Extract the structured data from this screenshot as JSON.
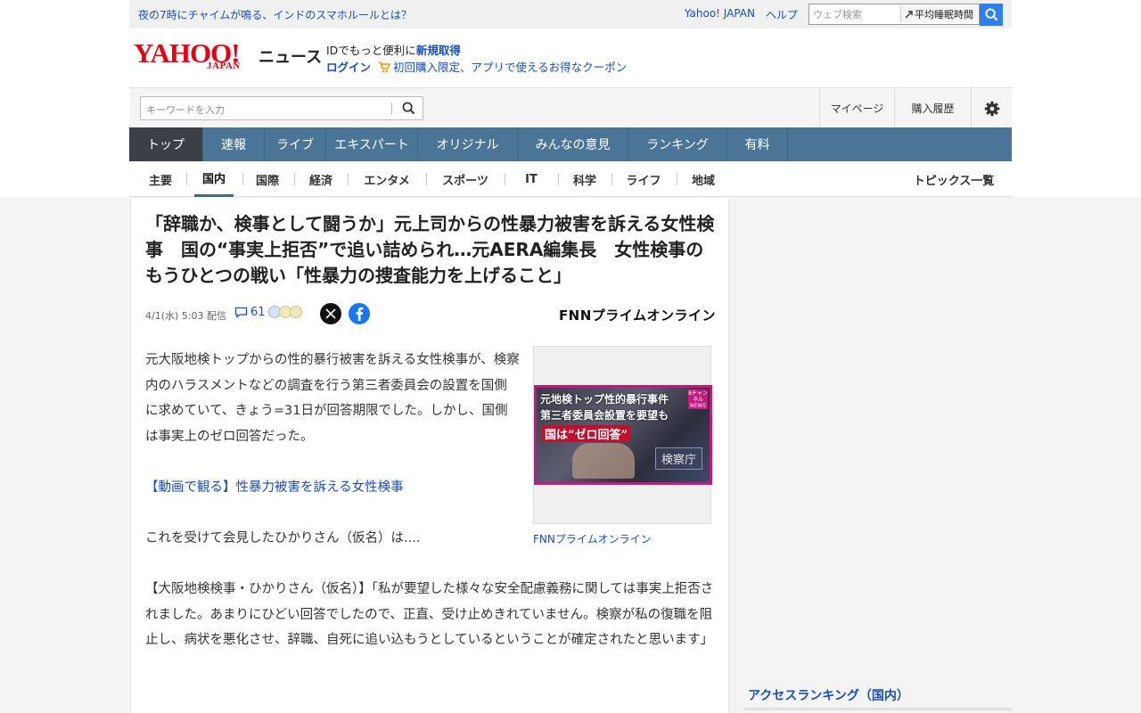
{
  "top_strip": {
    "headline": "夜の7時にチャイムが鳴る、インドのスマホルールとは？",
    "links": [
      "Yahoo! JAPAN",
      "ヘルプ"
    ],
    "web_search_placeholder": "ウェブ検索",
    "trend_word": "平均睡眠時間"
  },
  "header": {
    "logo_yahoo": "YAHOO!",
    "logo_japan": "JAPAN",
    "logo_news": "ニュース",
    "promo_line1_prefix": "IDでもっと便利に",
    "promo_line1_link": "新規取得",
    "promo_login": "ログイン",
    "promo_coupon": "初回購入限定、アプリで使えるお得なクーポン"
  },
  "search_row": {
    "placeholder": "キーワードを入力",
    "mypage": "マイページ",
    "purchase_history": "購入履歴"
  },
  "nav": {
    "tabs": [
      "トップ",
      "速報",
      "ライブ",
      "エキスパート",
      "オリジナル",
      "みんなの意見",
      "ランキング",
      "有料"
    ],
    "active": "トップ"
  },
  "subnav": {
    "items": [
      "主要",
      "国内",
      "国際",
      "経済",
      "エンタメ",
      "スポーツ",
      "IT",
      "科学",
      "ライフ",
      "地域"
    ],
    "active": "国内",
    "topics_list": "トピックス一覧"
  },
  "article": {
    "title": "「辞職か、検事として闘うか」元上司からの性暴力被害を訴える女性検事　国の“事実上拒否”で追い詰められ…元AERA編集長　女性検事のもうひとつの戦い「性暴力の捜査能力を上げること」",
    "date": "4/1(水) 5:03 配信",
    "comment_count": "61",
    "source": "FNNプライムオンライン",
    "source_logo": "FNNプライムオンライン",
    "paragraph1": "元大阪地検トップからの性的暴行被害を訴える女性検事が、検察内のハラスメントなどの調査を行う第三者委員会の設置を国側に求めていて、きょう=31日が回答期限でした。しかし、国側は事実上のゼロ回答だった。",
    "video_link": "【動画で観る】性暴力被害を訴える女性検事",
    "paragraph2": "これを受けて会見したひかりさん（仮名）は....",
    "paragraph3": "【大阪地検検事・ひかりさん（仮名）】「私が要望した様々な安全配慮義務に関しては事実上拒否されました。あまりにひどい回答でしたので、正直、受け止めきれていません。検察が私の復職を阻止し、病状を悪化させ、辞職、自死に追い込もうとしているということが確定されたと思います」",
    "image_caption": "FNNプライムオンライン",
    "image_text1": "元地検トップ性的暴行事件",
    "image_text2": "第三者委員会設置を要望も",
    "image_text3": "国は“ゼロ回答”",
    "image_text4": "検察庁",
    "image_badge": "8チャンネル NEWS"
  },
  "sidebar": {
    "ranking_title": "アクセスランキング（国内）"
  },
  "colors": {
    "link_blue": "#1a4dbd",
    "nav_blue": "#4b7596",
    "logo_red": "#e60012",
    "nav_active": "#3a3f48"
  }
}
